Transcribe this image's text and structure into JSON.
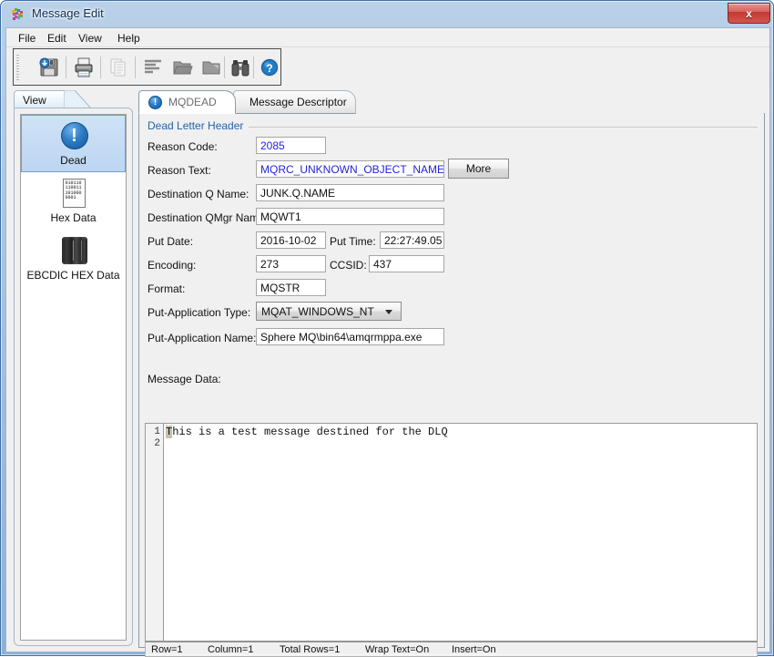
{
  "window": {
    "title": "Message Edit",
    "icon": "app-pinwheel-icon",
    "close_label": "x"
  },
  "menubar": {
    "items": [
      {
        "label": "File"
      },
      {
        "label": "Edit"
      },
      {
        "label": "View"
      },
      {
        "label": "Help"
      }
    ]
  },
  "toolbar": {
    "buttons": [
      {
        "name": "save-button",
        "icon": "floppy-save-icon",
        "enabled": true
      },
      {
        "name": "print-button",
        "icon": "printer-icon",
        "enabled": true
      },
      {
        "name": "copy-button",
        "icon": "copy-pages-icon",
        "enabled": false
      },
      {
        "name": "format-button",
        "icon": "align-lines-icon",
        "enabled": true
      },
      {
        "name": "open-folder-button",
        "icon": "folder-open-icon",
        "enabled": true
      },
      {
        "name": "close-folder-button",
        "icon": "folder-icon",
        "enabled": true
      },
      {
        "name": "find-button",
        "icon": "binoculars-icon",
        "enabled": true
      },
      {
        "name": "help-button",
        "icon": "help-question-icon",
        "enabled": true
      }
    ]
  },
  "view_panel": {
    "tab_label": "View",
    "items": [
      {
        "label": "Dead",
        "icon": "exclamation-circle-icon",
        "selected": true
      },
      {
        "label": "Hex Data",
        "icon": "binary-document-icon",
        "selected": false
      },
      {
        "label": "EBCDIC HEX Data",
        "icon": "mainframe-icon",
        "selected": false
      }
    ]
  },
  "main_panel": {
    "tabs": [
      {
        "label": "MQDEAD",
        "icon": "exclamation-circle-icon",
        "active": true
      },
      {
        "label": "Message Descriptor",
        "icon": "",
        "active": false
      }
    ],
    "group_title": "Dead Letter Header",
    "fields": [
      {
        "name": "reason-code",
        "label": "Reason Code:",
        "value": "2085",
        "style": "blue"
      },
      {
        "name": "reason-text",
        "label": "Reason Text:",
        "value": "MQRC_UNKNOWN_OBJECT_NAME",
        "style": "blue"
      },
      {
        "name": "destination-q-name",
        "label": "Destination Q Name:",
        "value": "JUNK.Q.NAME",
        "style": "plain"
      },
      {
        "name": "destination-qmgr-name",
        "label": "Destination QMgr Name:",
        "value": "MQWT1",
        "style": "plain"
      },
      {
        "name": "put-date",
        "label": "Put Date:",
        "value": "2016-10-02",
        "style": "plain"
      },
      {
        "name": "put-time",
        "label": "Put Time:",
        "value": "22:27:49.05",
        "style": "plain"
      },
      {
        "name": "encoding",
        "label": "Encoding:",
        "value": "273",
        "style": "plain"
      },
      {
        "name": "ccsid",
        "label": "CCSID:",
        "value": "437",
        "style": "plain"
      },
      {
        "name": "format",
        "label": "Format:",
        "value": "MQSTR",
        "style": "plain"
      },
      {
        "name": "put-application-name",
        "label": "Put-Application Name:",
        "value": "Sphere MQ\\bin64\\amqrmppa.exe",
        "style": "plain"
      }
    ],
    "more_button_label": "More",
    "put_application_type": {
      "label": "Put-Application Type:",
      "value": "MQAT_WINDOWS_NT"
    },
    "message_data": {
      "label": "Message Data:",
      "button_icon": "tree-structure-icon"
    }
  },
  "editor": {
    "line_numbers": [
      "1",
      "2"
    ],
    "caret_char": "T",
    "text_rest": "his is a test message destined for the DLQ",
    "full_text": "This is a test message destined for the DLQ"
  },
  "status_bar": {
    "row": "Row=1",
    "column": "Column=1",
    "total_rows": "Total Rows=1",
    "wrap_text": "Wrap Text=On",
    "insert": "Insert=On"
  },
  "colors": {
    "accent_blue": "#2563a8",
    "value_blue": "#2222dd",
    "selection_blue": "#bdd6f2",
    "window_border": "#3f6fa5",
    "face": "#f0f0f0"
  }
}
